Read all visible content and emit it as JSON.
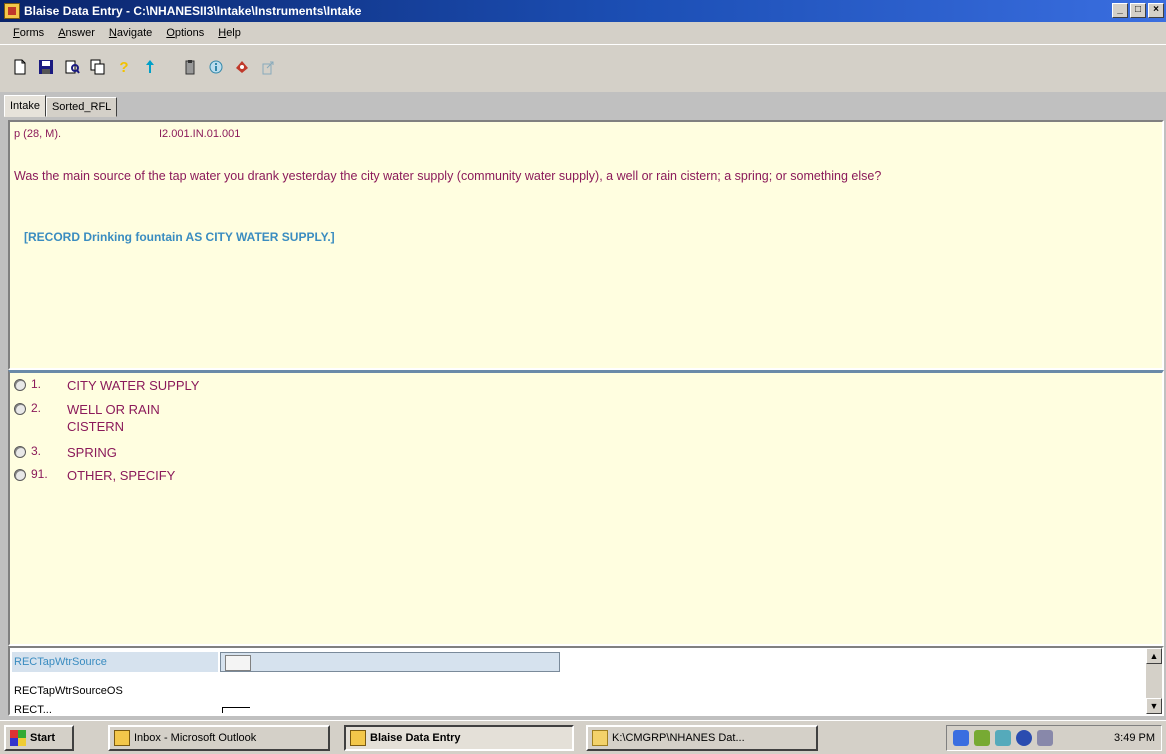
{
  "window": {
    "title": "Blaise Data Entry - C:\\NHANESII3\\Intake\\Instruments\\Intake",
    "minimize": "_",
    "maximize": "□",
    "close": "×"
  },
  "menu": [
    {
      "label": "Forms",
      "accel": "F",
      "rest": "orms"
    },
    {
      "label": "Answer",
      "accel": "A",
      "rest": "nswer"
    },
    {
      "label": "Navigate",
      "accel": "N",
      "rest": "avigate"
    },
    {
      "label": "Options",
      "accel": "O",
      "rest": "ptions"
    },
    {
      "label": "Help",
      "accel": "H",
      "rest": "elp"
    }
  ],
  "toolbar": {
    "icons": [
      "new-form-icon",
      "save-icon",
      "find-icon",
      "copy-icon",
      "help-question-icon",
      "info-arrow-icon",
      "clipboard-icon",
      "info-circle-icon",
      "remark-icon",
      "link-icon"
    ],
    "colors": {
      "help": "#f2c200",
      "info": "#00a0c8",
      "remark": "#c0392b"
    }
  },
  "tabs": [
    {
      "label": "Intake",
      "active": true
    },
    {
      "label": "Sorted_RFL",
      "active": false
    }
  ],
  "question": {
    "prefix": "p (28, M).",
    "code": "I2.001.IN.01.001",
    "text": "Was the main source of the tap water you drank yesterday the city water supply (community water supply), a well or rain cistern; a spring; or something else?",
    "instruction": "[RECORD Drinking fountain AS CITY WATER SUPPLY.]"
  },
  "answers": [
    {
      "num": "1.",
      "label": "CITY WATER SUPPLY"
    },
    {
      "num": "2.",
      "label": "WELL OR RAIN",
      "label2": "CISTERN"
    },
    {
      "num": "3.",
      "label": "SPRING"
    },
    {
      "num": "91.",
      "label": "OTHER, SPECIFY"
    }
  ],
  "fields": [
    {
      "name": "RECTapWtrSource",
      "active": true
    },
    {
      "name": "RECTapWtrSourceOS",
      "active": false
    },
    {
      "name": "RECT...",
      "active": false
    }
  ],
  "taskbar": {
    "start": "Start",
    "items": [
      {
        "label": "Inbox - Microsoft Outlook",
        "pressed": false
      },
      {
        "label": "Blaise Data Entry",
        "pressed": true
      },
      {
        "label": "K:\\CMGRP\\NHANES Dat...",
        "pressed": false
      }
    ],
    "clock": "3:49 PM"
  }
}
